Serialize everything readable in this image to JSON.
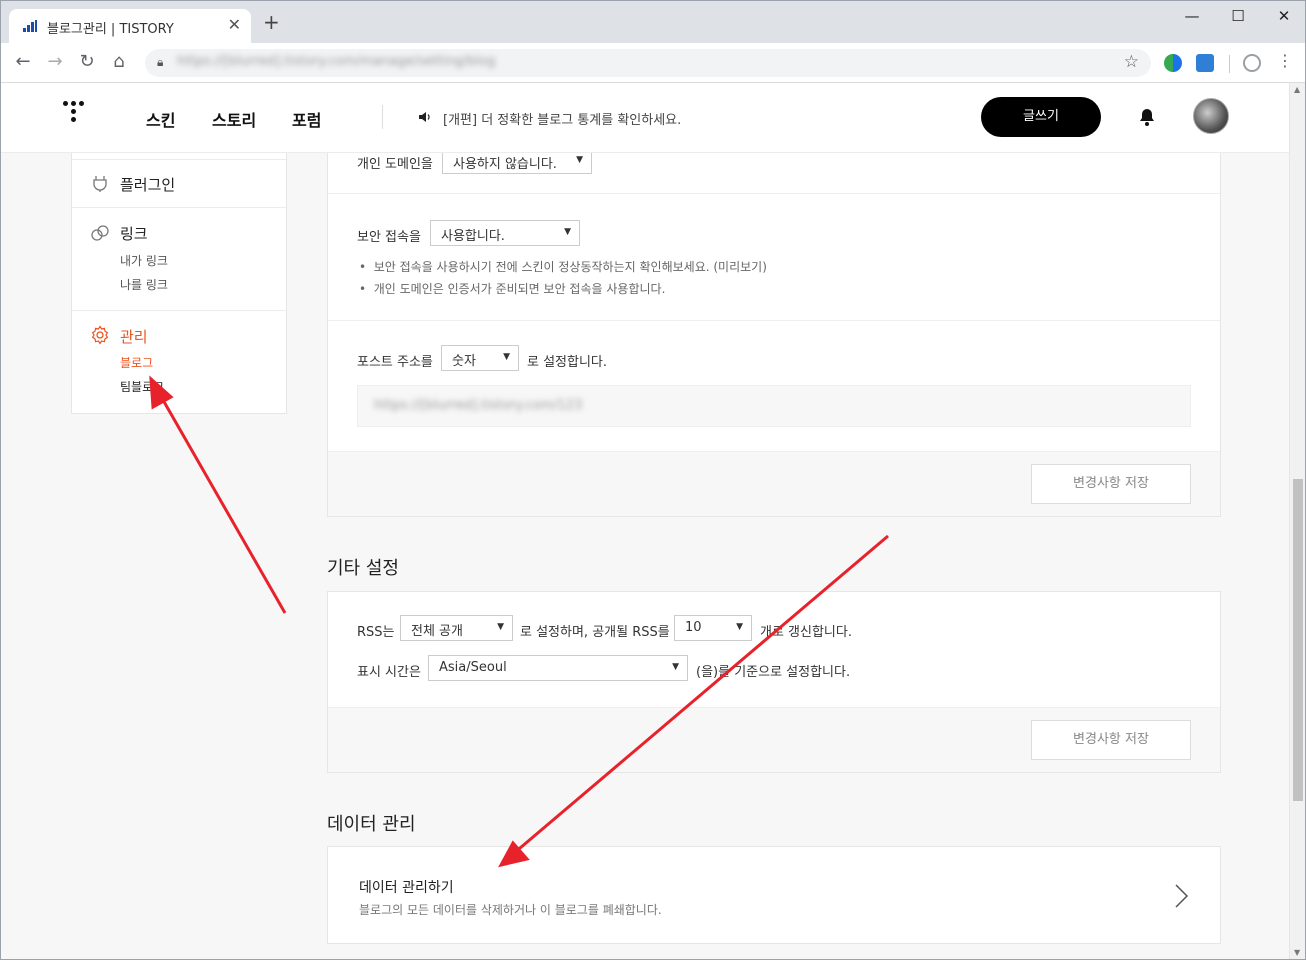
{
  "browser": {
    "tab_title": "블로그관리 | TISTORY",
    "tab_close": "✕",
    "new_tab": "+",
    "url": "https://[blurred].tistory.com/manage/setting/blog",
    "window_controls": [
      "—",
      "☐",
      "✕"
    ],
    "accent": "#1b4ea8"
  },
  "header": {
    "nav": [
      "스킨",
      "스토리",
      "포럼"
    ],
    "notice": "[개편] 더 정확한 블로그 통계를 확인하세요.",
    "write_label": "글쓰기"
  },
  "sidebar": {
    "plugin": "플러그인",
    "link": "링크",
    "link_items": [
      "내가 링크",
      "나를 링크"
    ],
    "manage": "관리",
    "manage_items": [
      "블로그",
      "팀블로그"
    ],
    "active_color": "#eb531f"
  },
  "domain_section": {
    "custom_domain_label": "개인 도메인을",
    "custom_domain_value": "사용하지 않습니다.",
    "secure_label": "보안 접속을",
    "secure_value": "사용합니다.",
    "notes": [
      "보안 접속을 사용하시기 전에 스킨이 정상동작하는지 확인해보세요. (미리보기)",
      "개인 도메인은 인증서가 준비되면 보안 접속을 사용합니다."
    ],
    "post_url_label": "포스트 주소를",
    "post_url_value": "숫자",
    "post_url_suffix": "로 설정합니다.",
    "post_url_example": "https://[blurred].tistory.com/123",
    "save_label": "변경사항 저장"
  },
  "etc_section": {
    "title": "기타 설정",
    "rss_label": "RSS는",
    "rss_value": "전체 공개",
    "rss_mid": "로 설정하며, 공개될 RSS를",
    "rss_count": "10",
    "rss_suffix": "개로 갱신합니다.",
    "tz_label": "표시 시간은",
    "tz_value": "Asia/Seoul",
    "tz_suffix": "(을)를 기준으로 설정합니다.",
    "save_label": "변경사항 저장"
  },
  "data_section": {
    "title": "데이터 관리",
    "item_title": "데이터 관리하기",
    "item_desc": "블로그의 모든 데이터를 삭제하거나 이 블로그를 폐쇄합니다."
  },
  "annotation_color": "#e8222a"
}
